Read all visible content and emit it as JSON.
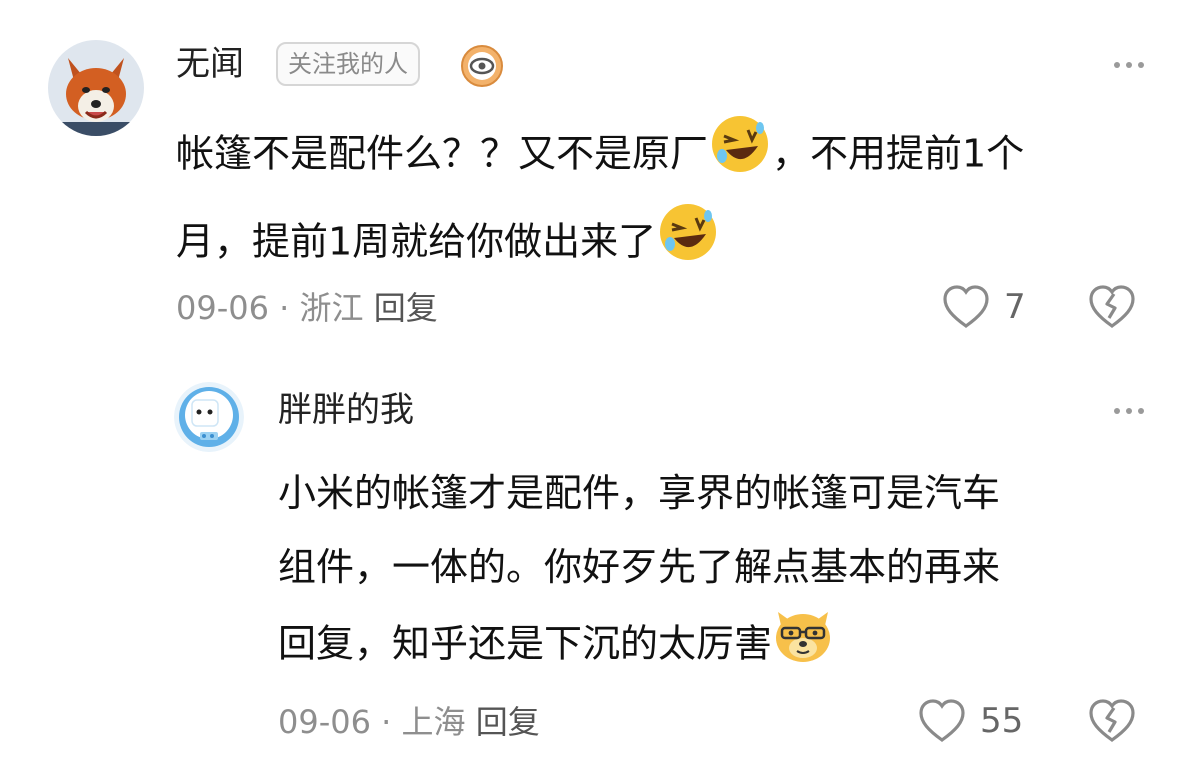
{
  "comments": [
    {
      "author": "无闻",
      "tag": "关注我的人",
      "text_line1": "帐篷不是配件么？？又不是原厂",
      "text_line1_end": "，不用提前1个",
      "text_line2": "月，提前1周就给你做出来了",
      "date": "09-06",
      "separator": "·",
      "location": "浙江",
      "reply_label": "回复",
      "likes": "7",
      "emoji": "rolling-on-floor-laughing-icon"
    },
    {
      "author": "胖胖的我",
      "text_line1": "小米的帐篷才是配件，享界的帐篷可是汽车",
      "text_line2": "组件，一体的。你好歹先了解点基本的再来",
      "text_line3": "回复，知乎还是下沉的太厉害",
      "date": "09-06",
      "separator": "·",
      "location": "上海",
      "reply_label": "回复",
      "likes": "55",
      "emoji": "doge-sunglasses-icon"
    }
  ],
  "colors": {
    "meta": "#8e8e8e",
    "emoji_yellow": "#f7c433",
    "avatar_blue": "#5fb0e8"
  }
}
